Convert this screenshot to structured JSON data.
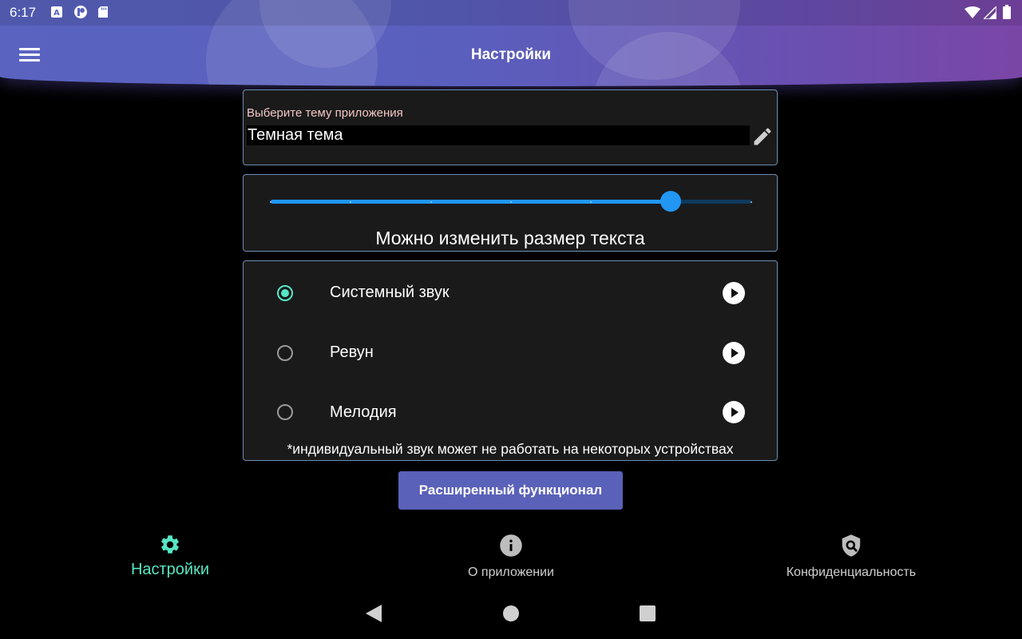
{
  "status_bar": {
    "time": "6:17",
    "icons": [
      "a-badge-icon",
      "record-icon",
      "sd-card-icon",
      "wifi-icon",
      "signal-icon",
      "battery-icon"
    ]
  },
  "app_bar": {
    "title": "Настройки",
    "menu_icon": "hamburger-icon",
    "gradient_colors": [
      "#5a63c0",
      "#7a46a6"
    ]
  },
  "theme_card": {
    "label": "Выберите тему приложения",
    "value": "Темная тема",
    "edit_icon": "pencil-icon"
  },
  "text_size_card": {
    "caption": "Можно изменить размер текста",
    "slider_value_fraction": 0.833,
    "steps": 7,
    "accent": "#2196f3"
  },
  "sound_card": {
    "options": [
      {
        "label": "Системный звук",
        "selected": true
      },
      {
        "label": "Ревун",
        "selected": false
      },
      {
        "label": "Мелодия",
        "selected": false
      }
    ],
    "note": "*индивидуальный звук может не работать на некоторых устройствах",
    "selected_color": "#56e6c4"
  },
  "extended_button": {
    "label": "Расширенный функционал"
  },
  "bottom_nav": {
    "items": [
      {
        "label": "Настройки",
        "icon": "gear-icon",
        "active": true
      },
      {
        "label": "О приложении",
        "icon": "info-icon",
        "active": false
      },
      {
        "label": "Конфиденциальность",
        "icon": "shield-search-icon",
        "active": false
      }
    ],
    "active_color": "#56e6c4"
  },
  "system_nav": {
    "icons": [
      "back-icon",
      "home-icon",
      "recents-icon"
    ]
  }
}
